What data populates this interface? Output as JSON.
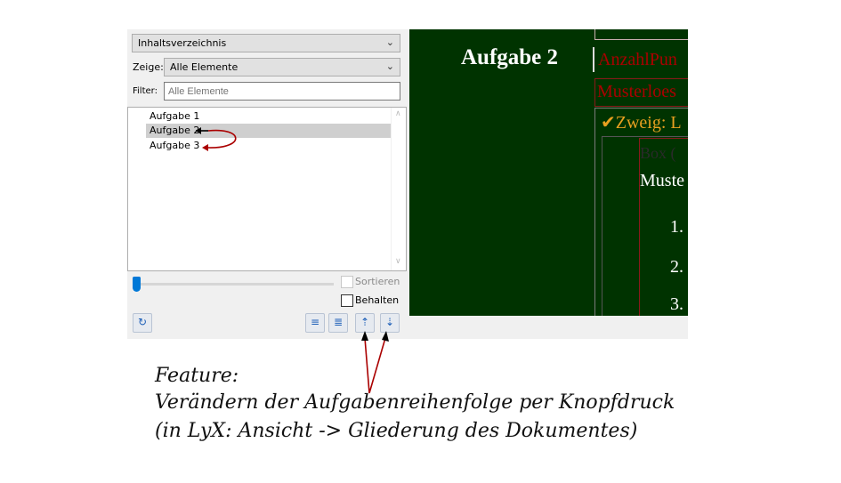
{
  "toc": {
    "type_combo": "Inhaltsverzeichnis",
    "zeige_label": "Zeige:",
    "zeige_value": "Alle Elemente",
    "filter_label": "Filter:",
    "filter_placeholder": "Alle Elemente",
    "items": [
      "Aufgabe 1",
      "Aufgabe 2",
      "Aufgabe 3"
    ],
    "selected_index": 1,
    "sort_label": "Sortieren",
    "keep_label": "Behalten"
  },
  "document": {
    "heading": "Aufgabe 2",
    "field1": "AnzahlPun",
    "field2": "Musterloes",
    "branch": "Zweig: L",
    "box_label": "Box (",
    "muster": "Muste",
    "list": [
      "1.",
      "2.",
      "3."
    ]
  },
  "caption": {
    "line1": "Feature:",
    "line2": "Verändern der Aufgabenreihenfolge per Knopfdruck",
    "line3": "(in LyX: Ansicht -> Gliederung des Dokumentes)"
  },
  "colors": {
    "doc_bg": "#003300",
    "accent_red": "#aa0000",
    "branch_orange": "#e8a020",
    "slider_blue": "#0078d7"
  },
  "icons": [
    "chevron-down-icon",
    "refresh-icon",
    "level-up-icon",
    "level-down-icon",
    "move-up-icon",
    "move-down-icon",
    "checkmark-icon"
  ]
}
